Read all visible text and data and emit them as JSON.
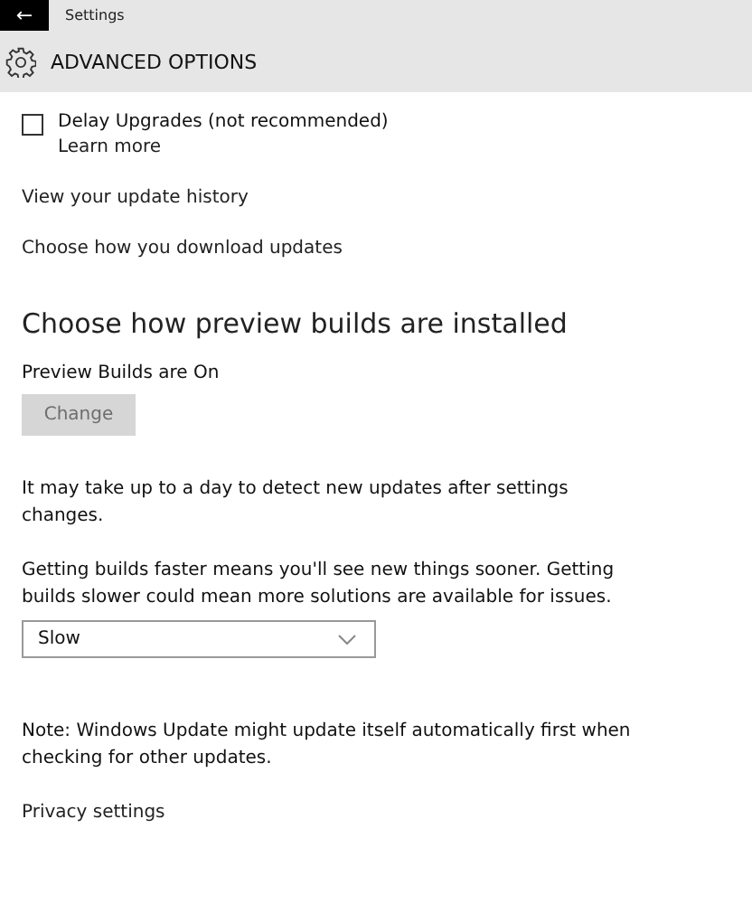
{
  "window": {
    "title": "Settings",
    "back": "←"
  },
  "header": {
    "title": "ADVANCED OPTIONS"
  },
  "delay_upgrades": {
    "label": "Delay Upgrades (not recommended)",
    "checked": false,
    "link": "Learn more"
  },
  "links": [
    "View your update history",
    "Choose how you download updates"
  ],
  "preview": {
    "heading": "Choose how preview builds are installed",
    "status": "Preview Builds are On",
    "button": {
      "label": "Change",
      "disabled": true
    },
    "info": "It may take up to a day to detect new updates after settings changes.",
    "speed_note": "Getting builds faster means you'll see new things sooner. Getting builds slower could mean more solutions are available for issues.",
    "speed": {
      "value": "Slow"
    }
  },
  "note": "Note: Windows Update might update itself automatically first when checking for other updates.",
  "footer_link": "Privacy settings"
}
